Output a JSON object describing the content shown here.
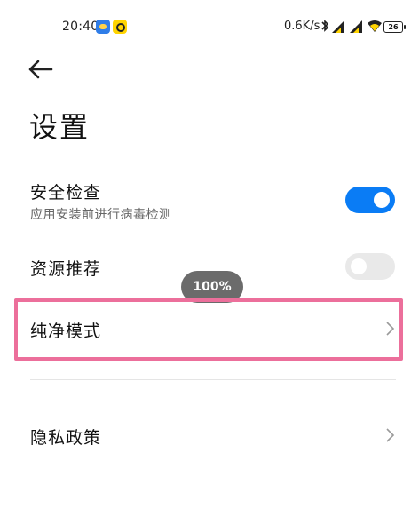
{
  "status_bar": {
    "time": "20:40",
    "net_speed": "0.6K/s",
    "battery": "26"
  },
  "header": {
    "title": "设置"
  },
  "settings": {
    "security_check": {
      "title": "安全检查",
      "subtitle": "应用安装前进行病毒检测",
      "enabled": true
    },
    "resource_recommend": {
      "title": "资源推荐",
      "enabled": false
    },
    "clean_mode": {
      "title": "纯净模式"
    },
    "privacy_policy": {
      "title": "隐私政策"
    }
  },
  "zoom_indicator": "100%",
  "colors": {
    "toggle_on": "#0a7cf5",
    "toggle_off": "#e9e9e9",
    "highlight": "#ec6f9b"
  }
}
